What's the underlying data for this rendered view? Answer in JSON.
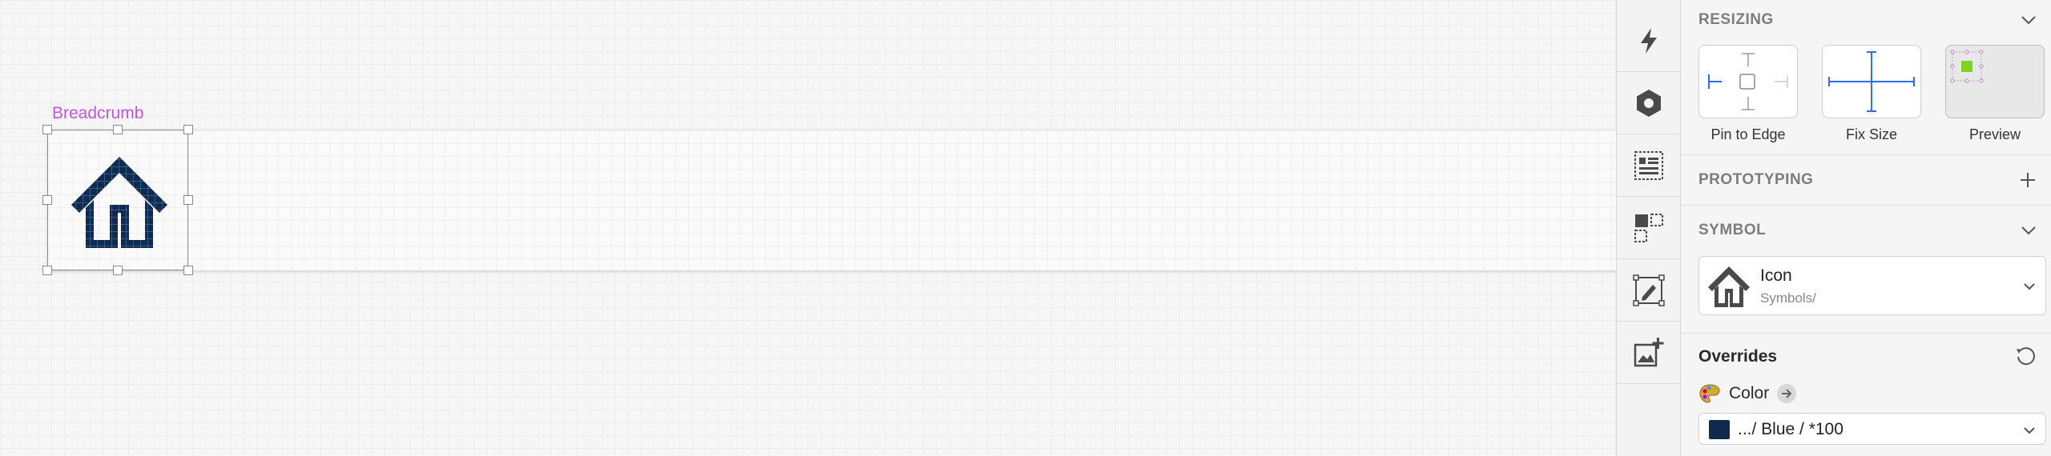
{
  "canvas": {
    "artboard_label": "Breadcrumb",
    "symbol_color": "#0f2a4d"
  },
  "toolbar": {
    "tools": [
      {
        "icon": "lightning-icon"
      },
      {
        "icon": "hexagon-nut-icon"
      },
      {
        "icon": "text-layout-icon"
      },
      {
        "icon": "symbol-overrides-icon"
      },
      {
        "icon": "edit-vector-icon"
      },
      {
        "icon": "add-image-icon"
      }
    ]
  },
  "inspector": {
    "resizing": {
      "title": "RESIZING",
      "options": [
        {
          "label": "Pin to Edge"
        },
        {
          "label": "Fix Size"
        },
        {
          "label": "Preview"
        }
      ],
      "pin_accent": "#2d6ee8",
      "preview_accent": "#7ed321"
    },
    "prototyping": {
      "title": "PROTOTYPING"
    },
    "symbol": {
      "title": "SYMBOL",
      "name": "Icon",
      "path": "Symbols/"
    },
    "overrides": {
      "title": "Overrides",
      "color_label": "Color",
      "color_value": ".../ Blue / *100",
      "color_hex": "#0f2a4d"
    }
  }
}
